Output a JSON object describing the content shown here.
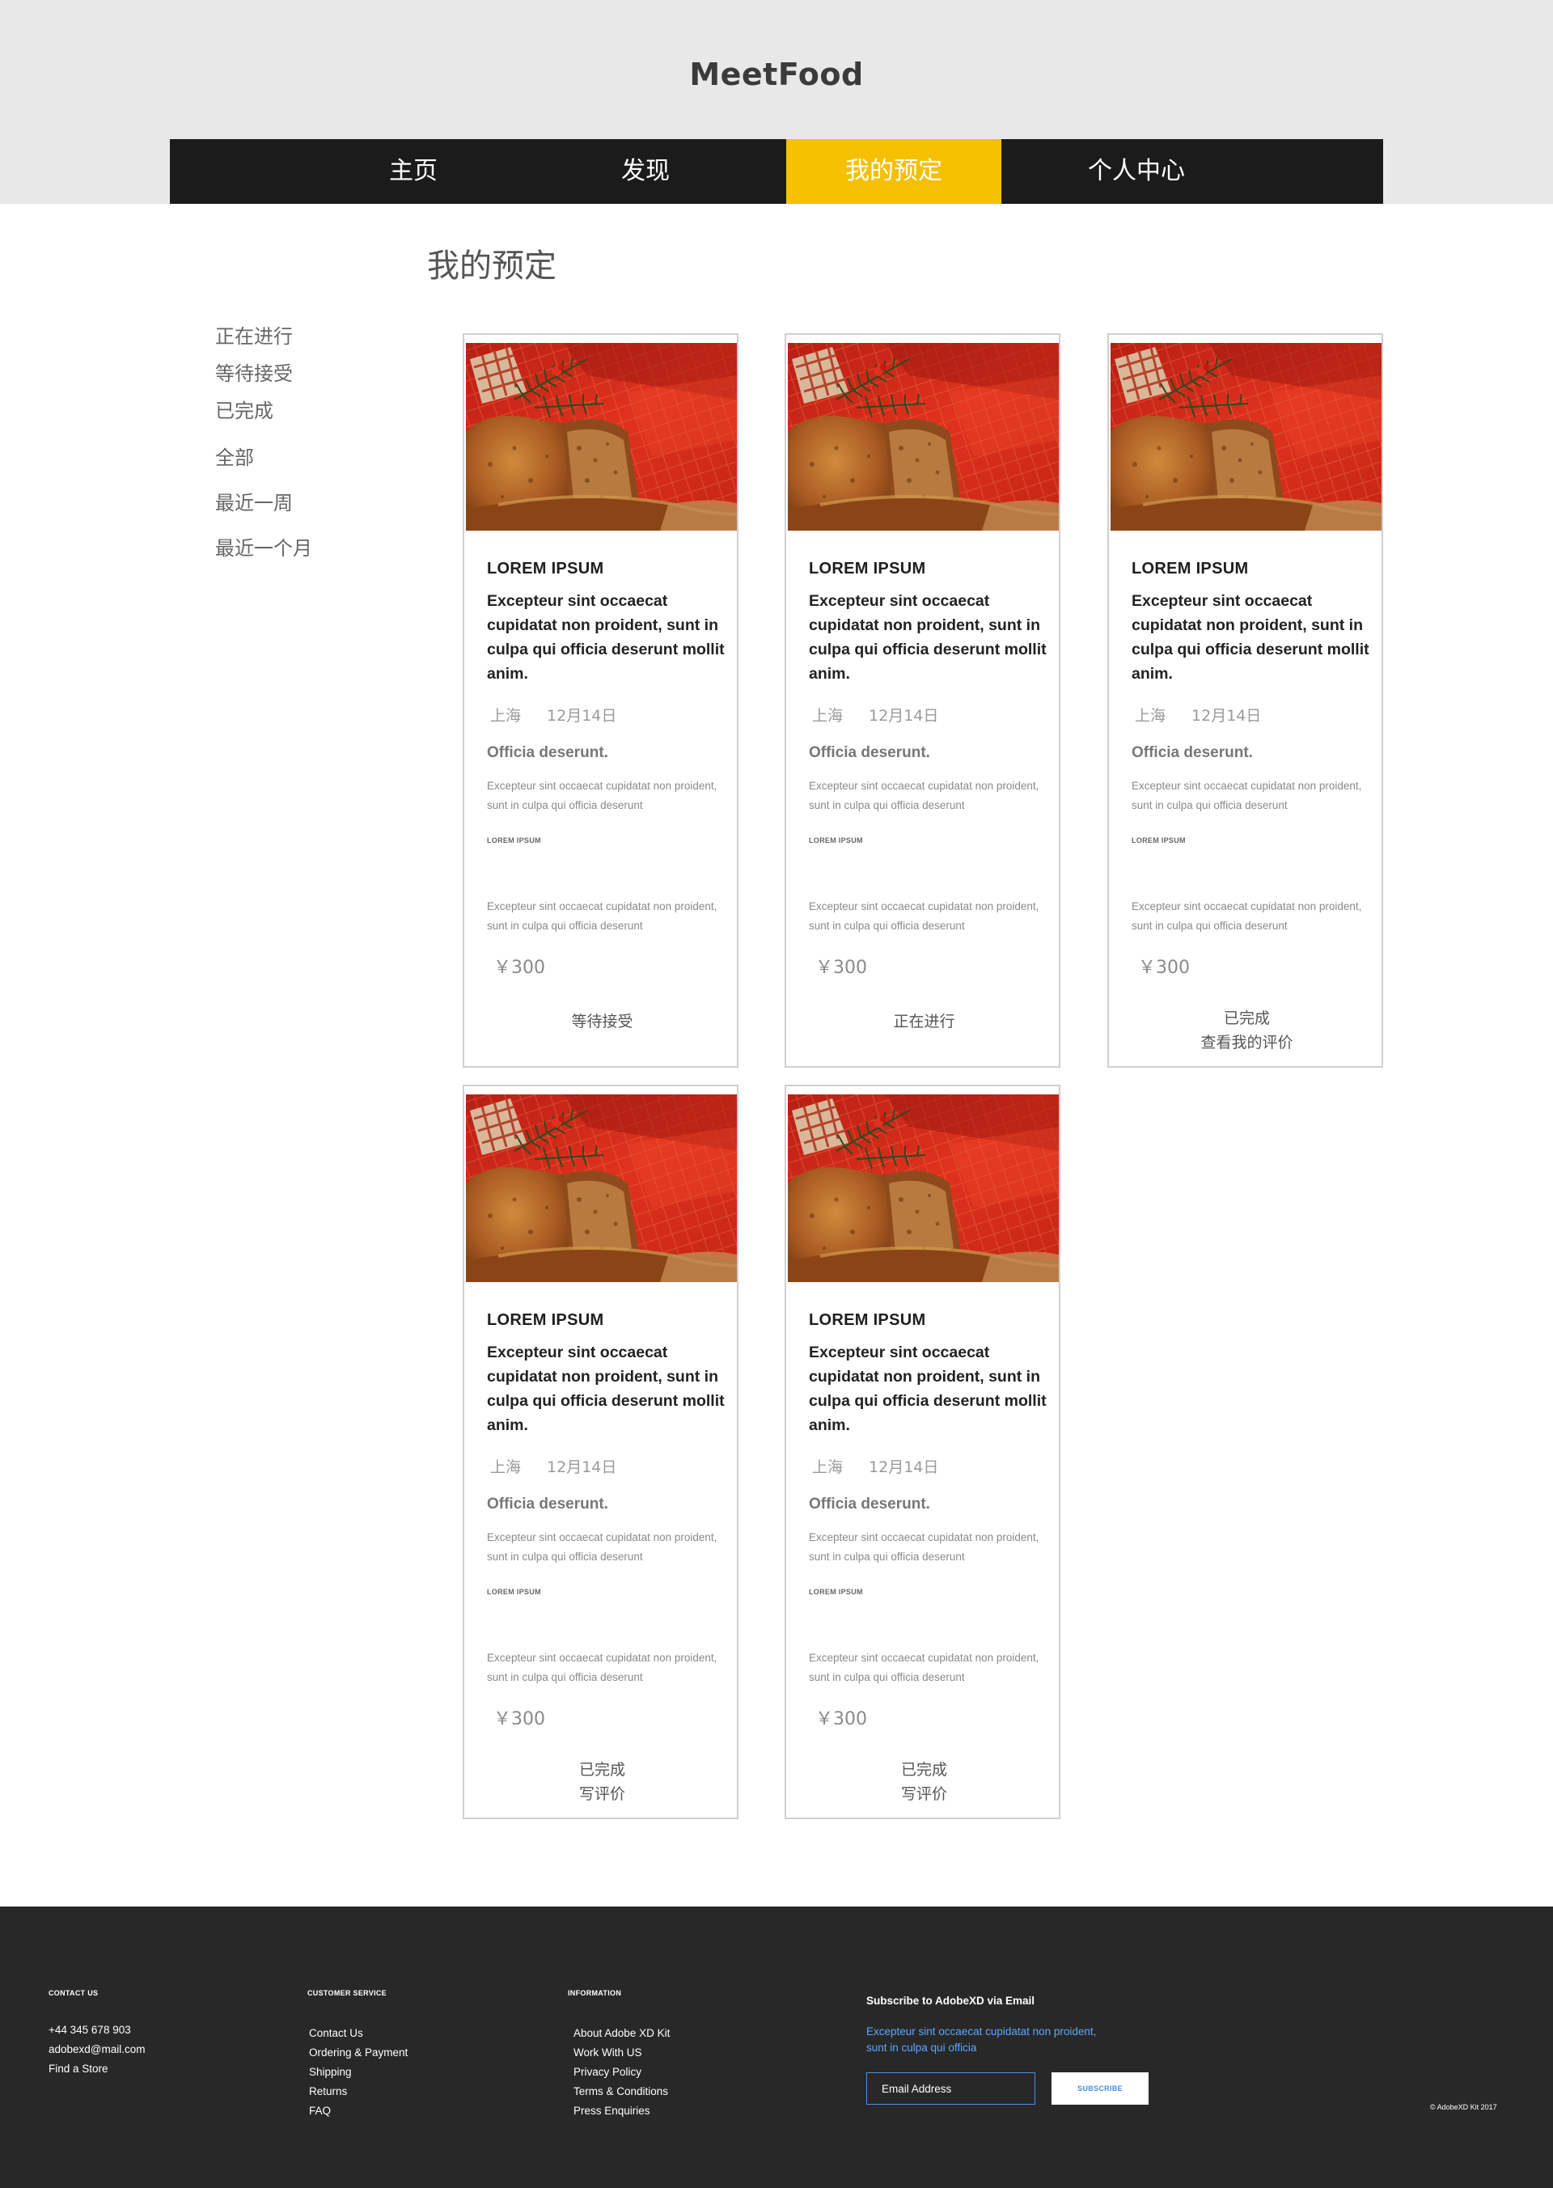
{
  "brand": "MeetFood",
  "nav": [
    {
      "label": "主页"
    },
    {
      "label": "发现"
    },
    {
      "label": "我的预定",
      "active": true
    },
    {
      "label": "个人中心"
    }
  ],
  "page_title": "我的预定",
  "sidebar": {
    "items": [
      {
        "label": "正在进行"
      },
      {
        "label": "等待接受"
      },
      {
        "label": "已完成"
      },
      {
        "label": "全部"
      },
      {
        "label": "最近一周"
      },
      {
        "label": "最近一个月"
      }
    ]
  },
  "cards": [
    {
      "title": "LOREM IPSUM",
      "desc": "Excepteur sint occaecat cupidatat non proident, sunt in culpa qui officia deserunt mollit anim.",
      "city": "上海",
      "date": "12月14日",
      "subtitle": "Officia deserunt.",
      "text1": "Excepteur sint occaecat cupidatat non proident, sunt in culpa qui officia deserunt",
      "small_label": "LOREM IPSUM",
      "text2": "Excepteur sint occaecat cupidatat non proident, sunt in culpa qui officia deserunt",
      "price": "￥300",
      "status_line1": "等待接受",
      "status_line2": ""
    },
    {
      "title": "LOREM IPSUM",
      "desc": "Excepteur sint occaecat cupidatat non proident, sunt in culpa qui officia deserunt mollit anim.",
      "city": "上海",
      "date": "12月14日",
      "subtitle": "Officia deserunt.",
      "text1": "Excepteur sint occaecat cupidatat non proident, sunt in culpa qui officia deserunt",
      "small_label": "LOREM IPSUM",
      "text2": "Excepteur sint occaecat cupidatat non proident, sunt in culpa qui officia deserunt",
      "price": "￥300",
      "status_line1": "正在进行",
      "status_line2": ""
    },
    {
      "title": "LOREM IPSUM",
      "desc": "Excepteur sint occaecat cupidatat non proident, sunt in culpa qui officia deserunt mollit anim.",
      "city": "上海",
      "date": "12月14日",
      "subtitle": "Officia deserunt.",
      "text1": "Excepteur sint occaecat cupidatat non proident, sunt in culpa qui officia deserunt",
      "small_label": "LOREM IPSUM",
      "text2": "Excepteur sint occaecat cupidatat non proident, sunt in culpa qui officia deserunt",
      "price": "￥300",
      "status_line1": "已完成",
      "status_line2": "查看我的评价"
    },
    {
      "title": "LOREM IPSUM",
      "desc": "Excepteur sint occaecat cupidatat non proident, sunt in culpa qui officia deserunt mollit anim.",
      "city": "上海",
      "date": "12月14日",
      "subtitle": "Officia deserunt.",
      "text1": "Excepteur sint occaecat cupidatat non proident, sunt in culpa qui officia deserunt",
      "small_label": "LOREM IPSUM",
      "text2": "Excepteur sint occaecat cupidatat non proident, sunt in culpa qui officia deserunt",
      "price": "￥300",
      "status_line1": "已完成",
      "status_line2": "写评价"
    },
    {
      "title": "LOREM IPSUM",
      "desc": "Excepteur sint occaecat cupidatat non proident, sunt in culpa qui officia deserunt mollit anim.",
      "city": "上海",
      "date": "12月14日",
      "subtitle": "Officia deserunt.",
      "text1": "Excepteur sint occaecat cupidatat non proident, sunt in culpa qui officia deserunt",
      "small_label": "LOREM IPSUM",
      "text2": "Excepteur sint occaecat cupidatat non proident, sunt in culpa qui officia deserunt",
      "price": "￥300",
      "status_line1": "已完成",
      "status_line2": "写评价"
    }
  ],
  "footer": {
    "contact": {
      "title": "CONTACT US",
      "phone": "+44 345 678 903",
      "email": "adobexd@mail.com",
      "store": "Find a Store"
    },
    "service": {
      "title": "CUSTOMER SERVICE",
      "links": [
        "Contact Us",
        "Ordering & Payment",
        "Shipping",
        "Returns",
        "FAQ"
      ]
    },
    "information": {
      "title": "INFORMATION",
      "links": [
        "About Adobe XD Kit",
        "Work With US",
        "Privacy Policy",
        "Terms & Conditions",
        "Press Enquiries"
      ]
    },
    "subscribe": {
      "title": "Subscribe to AdobeXD via Email",
      "text": "Excepteur sint occaecat cupidatat non proident, sunt in culpa qui officia",
      "email_placeholder": "Email Address",
      "button": "SUBSCRIBE"
    },
    "copyright": "© AdobeXD Kit 2017"
  },
  "colors": {
    "accent": "#f5c000",
    "nav_bg": "#1b1b1b",
    "header_bg": "#e8e8e8",
    "footer_bg": "#282828",
    "link_blue": "#4a90e2"
  }
}
